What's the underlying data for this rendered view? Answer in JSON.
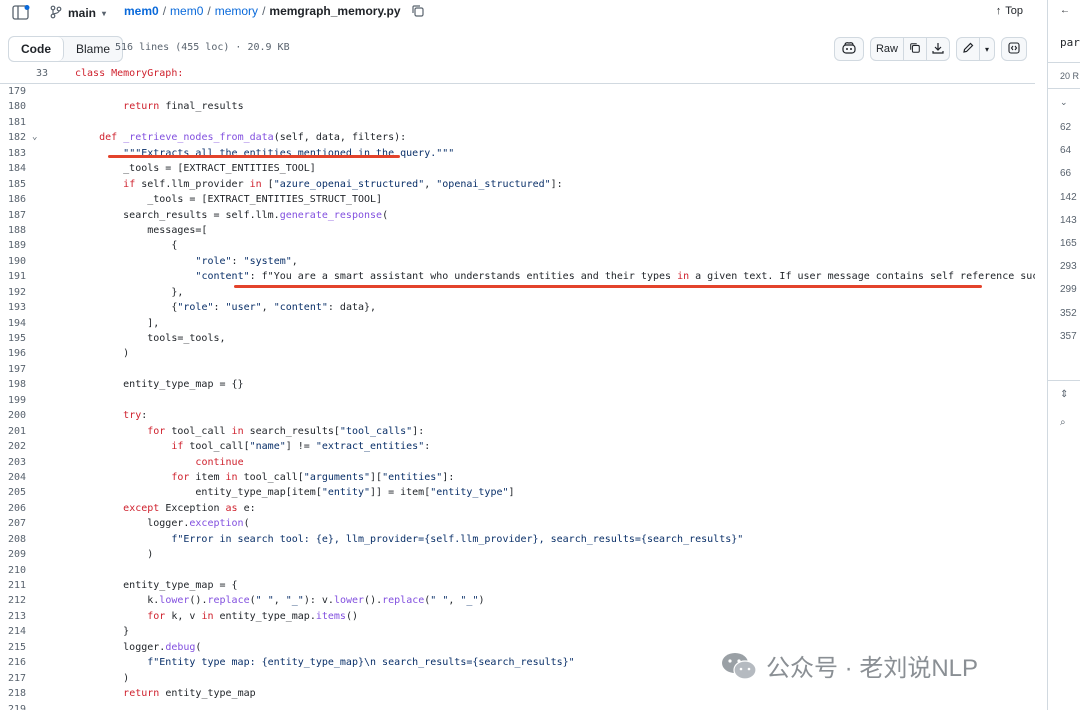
{
  "header": {
    "branch": "main",
    "breadcrumb": {
      "repo": "mem0",
      "dir1": "mem0",
      "dir2": "memory",
      "file": "memgraph_memory.py",
      "sep": "/"
    },
    "top_label": "Top"
  },
  "toolbar": {
    "code_tab": "Code",
    "blame_tab": "Blame",
    "file_info": "516 lines (455 loc) · 20.9 KB",
    "raw_label": "Raw"
  },
  "sticky": {
    "line": "33",
    "code": "class MemoryGraph:"
  },
  "code_lines": [
    {
      "n": "179",
      "c": ""
    },
    {
      "n": "180",
      "c": "        return final_results"
    },
    {
      "n": "181",
      "c": ""
    },
    {
      "n": "182",
      "c": "    def _retrieve_nodes_from_data(self, data, filters):"
    },
    {
      "n": "183",
      "c": "        \"\"\"Extracts all the entities mentioned in the query.\"\"\""
    },
    {
      "n": "184",
      "c": "        _tools = [EXTRACT_ENTITIES_TOOL]"
    },
    {
      "n": "185",
      "c": "        if self.llm_provider in [\"azure_openai_structured\", \"openai_structured\"]:"
    },
    {
      "n": "186",
      "c": "            _tools = [EXTRACT_ENTITIES_STRUCT_TOOL]"
    },
    {
      "n": "187",
      "c": "        search_results = self.llm.generate_response("
    },
    {
      "n": "188",
      "c": "            messages=["
    },
    {
      "n": "189",
      "c": "                {"
    },
    {
      "n": "190",
      "c": "                    \"role\": \"system\","
    },
    {
      "n": "191",
      "c": "                    \"content\": f\"You are a smart assistant who understands entities and their types in a given text. If user message contains self reference such as 'I', 'me',"
    },
    {
      "n": "192",
      "c": "                },"
    },
    {
      "n": "193",
      "c": "                {\"role\": \"user\", \"content\": data},"
    },
    {
      "n": "194",
      "c": "            ],"
    },
    {
      "n": "195",
      "c": "            tools=_tools,"
    },
    {
      "n": "196",
      "c": "        )"
    },
    {
      "n": "197",
      "c": ""
    },
    {
      "n": "198",
      "c": "        entity_type_map = {}"
    },
    {
      "n": "199",
      "c": ""
    },
    {
      "n": "200",
      "c": "        try:"
    },
    {
      "n": "201",
      "c": "            for tool_call in search_results[\"tool_calls\"]:"
    },
    {
      "n": "202",
      "c": "                if tool_call[\"name\"] != \"extract_entities\":"
    },
    {
      "n": "203",
      "c": "                    continue"
    },
    {
      "n": "204",
      "c": "                for item in tool_call[\"arguments\"][\"entities\"]:"
    },
    {
      "n": "205",
      "c": "                    entity_type_map[item[\"entity\"]] = item[\"entity_type\"]"
    },
    {
      "n": "206",
      "c": "        except Exception as e:"
    },
    {
      "n": "207",
      "c": "            logger.exception("
    },
    {
      "n": "208",
      "c": "                f\"Error in search tool: {e}, llm_provider={self.llm_provider}, search_results={search_results}\""
    },
    {
      "n": "209",
      "c": "            )"
    },
    {
      "n": "210",
      "c": ""
    },
    {
      "n": "211",
      "c": "        entity_type_map = {"
    },
    {
      "n": "212",
      "c": "            k.lower().replace(\" \", \"_\"): v.lower().replace(\" \", \"_\")"
    },
    {
      "n": "213",
      "c": "            for k, v in entity_type_map.items()"
    },
    {
      "n": "214",
      "c": "        }"
    },
    {
      "n": "215",
      "c": "        logger.debug("
    },
    {
      "n": "216",
      "c": "            f\"Entity type map: {entity_type_map}\\n search_results={search_results}\""
    },
    {
      "n": "217",
      "c": "        )"
    },
    {
      "n": "218",
      "c": "        return entity_type_map"
    },
    {
      "n": "219",
      "c": ""
    }
  ],
  "sidebar": {
    "top_text": "par",
    "count_text": "20 R",
    "lines": [
      "62",
      "64",
      "66",
      "142",
      "143",
      "165",
      "293",
      "299",
      "352",
      "357"
    ]
  },
  "watermark": {
    "text": "公众号 · 老刘说NLP"
  },
  "colors": {
    "link": "#0969da",
    "keyword": "#cf222e",
    "function": "#8250df",
    "string": "#0a3069",
    "underline": "#e3432b"
  }
}
